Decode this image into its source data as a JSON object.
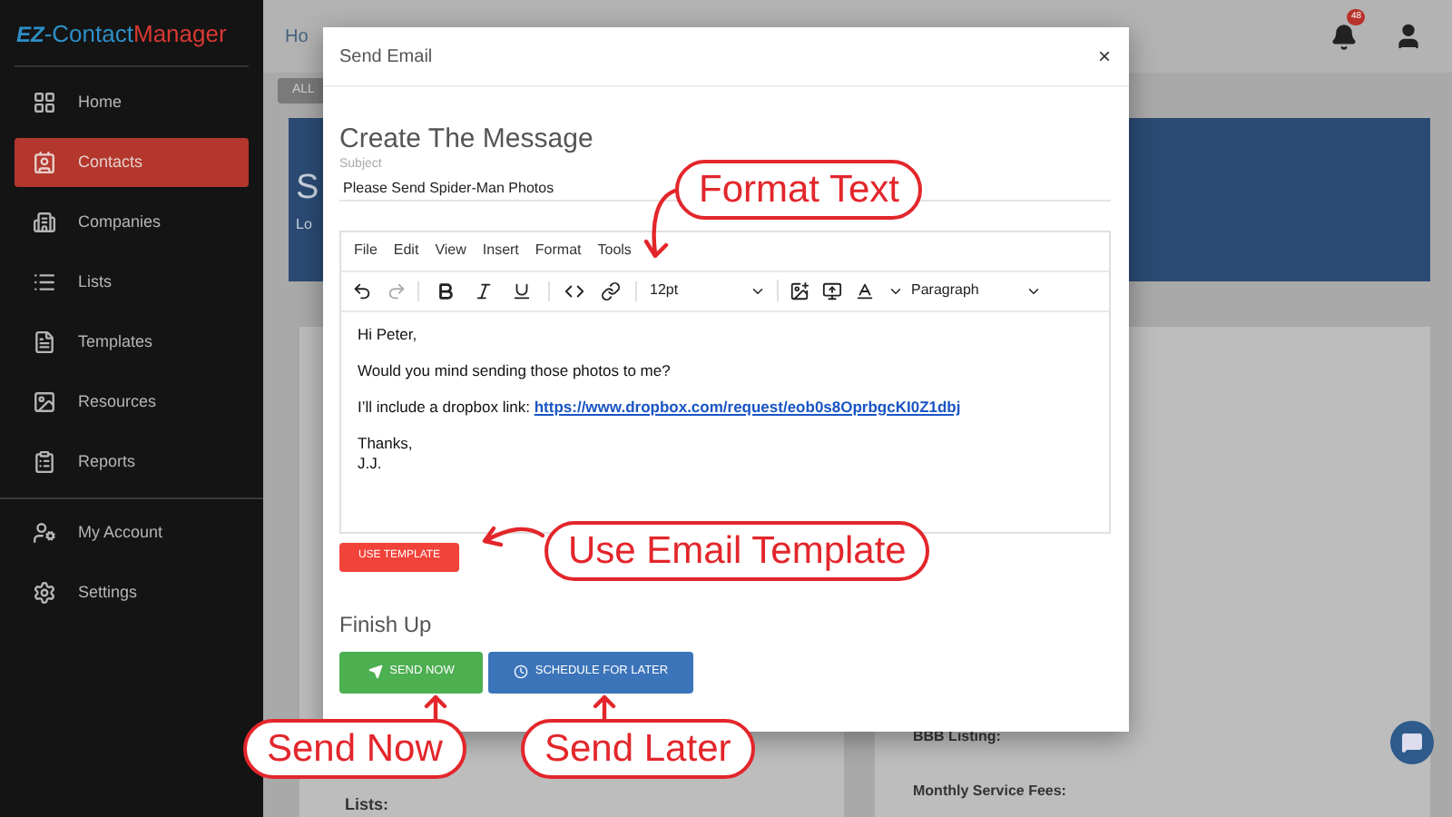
{
  "sidebar": {
    "logo": {
      "mark": "EZ",
      "first": "-Contact",
      "second": "Manager"
    },
    "items": [
      {
        "label": "Home",
        "selected": false
      },
      {
        "label": "Contacts",
        "selected": true
      },
      {
        "label": "Companies",
        "selected": false
      },
      {
        "label": "Lists",
        "selected": false
      },
      {
        "label": "Templates",
        "selected": false
      },
      {
        "label": "Resources",
        "selected": false
      },
      {
        "label": "Reports",
        "selected": false
      }
    ],
    "footer_items": [
      {
        "label": "My Account",
        "selected": false
      },
      {
        "label": "Settings",
        "selected": false
      }
    ]
  },
  "header": {
    "breadcrumb": "Ho",
    "notification_count": "48"
  },
  "background": {
    "filter_button": "ALL",
    "banner_title": "S",
    "banner_subtitle": "Lo",
    "left_card_label": "Lists:",
    "right_card_labels": [
      "BBB Listing:",
      "Monthly Service Fees:"
    ]
  },
  "dialog": {
    "title": "Send Email",
    "close": "×",
    "section_title": "Create The Message",
    "subject_label": "Subject",
    "subject_value": "Please Send Spider-Man Photos",
    "menu": [
      "File",
      "Edit",
      "View",
      "Insert",
      "Format",
      "Tools"
    ],
    "toolbar": {
      "undo_disabled": false,
      "redo_disabled": true,
      "font_size": "12pt",
      "block_format": "Paragraph"
    },
    "body": [
      {
        "lines": [
          "Hi Peter,"
        ]
      },
      {
        "lines": [
          "Would you mind sending those photos to me?"
        ]
      },
      {
        "lines": [
          "I’ll include a dropbox link:"
        ],
        "link": "https://www.dropbox.com/request/eob0s8OprbgcKI0Z1dbj"
      },
      {
        "lines": [
          "Thanks,",
          "J.J."
        ]
      }
    ],
    "template_button": "USE TEMPLATE",
    "finish_title": "Finish Up",
    "send_button": "SEND NOW",
    "schedule_button": "SCHEDULE FOR LATER"
  },
  "callouts": [
    {
      "text": "Format Text",
      "kind": "left"
    },
    {
      "text": "Use Email Template",
      "kind": "left"
    },
    {
      "text": "Send Now",
      "kind": "up"
    },
    {
      "text": "Send Later",
      "kind": "up"
    }
  ]
}
